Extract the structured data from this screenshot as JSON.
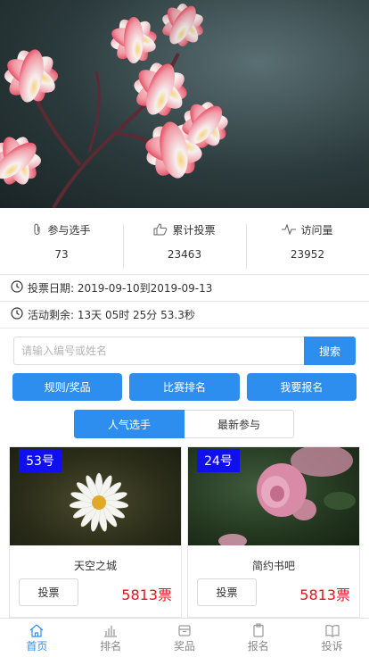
{
  "hero": {
    "image": "frangipani-flowers-photo"
  },
  "stats": [
    {
      "icon": "paperclip-icon",
      "label": "参与选手",
      "value": "73"
    },
    {
      "icon": "thumbs-up-icon",
      "label": "累计投票",
      "value": "23463"
    },
    {
      "icon": "pulse-icon",
      "label": "访问量",
      "value": "23952"
    }
  ],
  "info": {
    "vote_date": "投票日期: 2019-09-10到2019-09-13",
    "remaining": "活动剩余: 13天 05时 25分 53.3秒"
  },
  "search": {
    "placeholder": "请输入编号或姓名",
    "button": "搜索"
  },
  "actions": {
    "rules": "规则/奖品",
    "ranking": "比赛排名",
    "signup": "我要报名"
  },
  "tabs": {
    "popular": "人气选手",
    "latest": "最新参与",
    "active": "popular"
  },
  "cards": [
    {
      "badge": "53号",
      "name": "天空之城",
      "vote_label": "投票",
      "votes": "5813票",
      "photo": "white-daisy-photo"
    },
    {
      "badge": "24号",
      "name": "简约书吧",
      "vote_label": "投票",
      "votes": "5813票",
      "photo": "pink-roses-photo"
    }
  ],
  "nav": [
    {
      "icon": "home-icon",
      "label": "首页",
      "active": true
    },
    {
      "icon": "bar-chart-icon",
      "label": "排名",
      "active": false
    },
    {
      "icon": "prize-box-icon",
      "label": "奖品",
      "active": false
    },
    {
      "icon": "clipboard-icon",
      "label": "报名",
      "active": false
    },
    {
      "icon": "book-icon",
      "label": "投诉",
      "active": false
    }
  ],
  "colors": {
    "accent": "#2e8ef0",
    "badge": "#0f0ff0",
    "votes": "#e8141e"
  }
}
